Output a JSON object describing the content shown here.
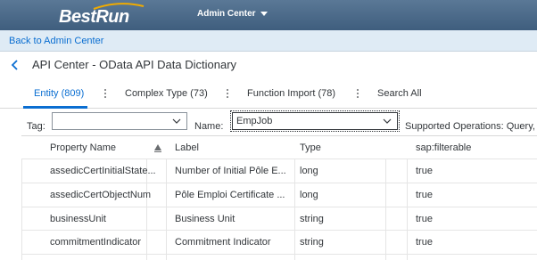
{
  "shell": {
    "logo": "BestRun",
    "menu_label": "Admin Center"
  },
  "back_link": "Back to Admin Center",
  "page_title": "API Center - OData API Data Dictionary",
  "tabs": [
    {
      "label": "Entity (809)",
      "active": true
    },
    {
      "label": "Complex Type (73)",
      "active": false
    },
    {
      "label": "Function Import (78)",
      "active": false
    },
    {
      "label": "Search All",
      "active": false
    }
  ],
  "filters": {
    "tag_label": "Tag:",
    "tag_value": "",
    "name_label": "Name:",
    "name_value": "EmpJob",
    "supported_operations": "Supported Operations: Query,"
  },
  "table": {
    "columns": [
      "Property Name",
      "Label",
      "Type",
      "",
      "sap:filterable"
    ],
    "rows": [
      {
        "property": "assedicCertInitialState...",
        "label": "Number of Initial Pôle E...",
        "type": "long",
        "extra": "",
        "filterable": "true"
      },
      {
        "property": "assedicCertObjectNum",
        "label": "Pôle Emploi Certificate ...",
        "type": "long",
        "extra": "",
        "filterable": "true"
      },
      {
        "property": "businessUnit",
        "label": "Business Unit",
        "type": "string",
        "extra": "",
        "filterable": "true"
      },
      {
        "property": "commitmentIndicator",
        "label": "Commitment Indicator",
        "type": "string",
        "extra": "",
        "filterable": "true"
      }
    ]
  },
  "colors": {
    "header_bg": "#4a6a8a",
    "back_bar_bg": "#dfebf5",
    "accent": "#0a6ed1",
    "text": "#32363a"
  }
}
